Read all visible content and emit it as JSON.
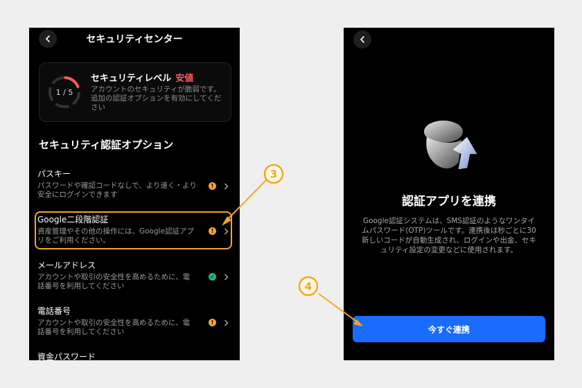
{
  "left": {
    "title": "セキュリティセンター",
    "level": {
      "score": "1 / 5",
      "title": "セキュリティレベル",
      "state": "安値",
      "state_color": "#ff5a5a",
      "description": "アカウントのセキュリティが脆弱です。追加の認証オプションを有効にしてください"
    },
    "section_title": "セキュリティ認証オプション",
    "options": [
      {
        "name": "パスキー",
        "description": "パスワードや確認コードなしで、より速く・より安全にログインできます",
        "status": "warning"
      },
      {
        "name": "Google二段階認証",
        "description": "資産管理やその他の操作には、Google認証アプリをご利用ください。",
        "status": "warning"
      },
      {
        "name": "メールアドレス",
        "description": "アカウントや取引の安全性を高めるために、電話番号を利用してください",
        "status": "verified"
      },
      {
        "name": "電話番号",
        "description": "アカウントや取引の安全性を高めるために、電話番号を利用してください",
        "status": "warning"
      },
      {
        "name": "資金パスワード",
        "description": "",
        "status": "none"
      }
    ]
  },
  "right": {
    "title": "認証アプリを連携",
    "description": "Google認証システムは、SMS認証のようなワンタイムパスワード(OTP)ツールです。連携後は秒ごとに30新しいコードが自動生成され、ログインや出金、セキュリティ設定の変更などに使用されます。",
    "button_label": "今すぐ連携",
    "button_color": "#1a6bff"
  },
  "annotations": {
    "step3": "③",
    "step4": "④",
    "color": "#f5a623"
  }
}
